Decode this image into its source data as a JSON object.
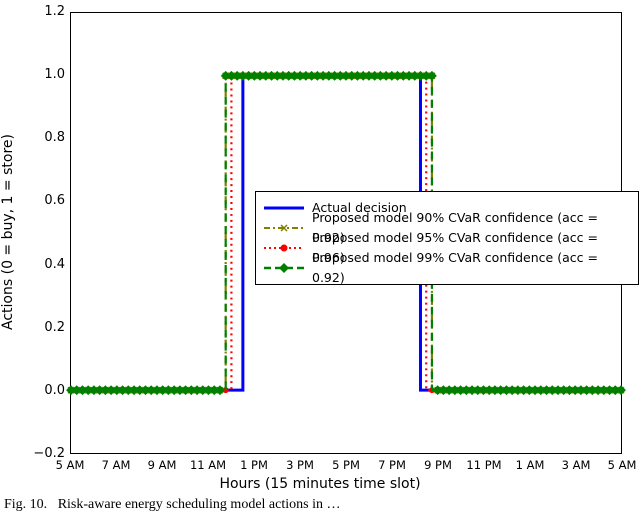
{
  "chart_data": {
    "type": "line",
    "title": "",
    "xlabel": "Hours (15 minutes time slot)",
    "ylabel": "Actions (0 = buy, 1 = store)",
    "xlim_hours": [
      5,
      29
    ],
    "ylim": [
      -0.2,
      1.2
    ],
    "x_tick_labels": [
      "5 AM",
      "7 AM",
      "9 AM",
      "11 AM",
      "1 PM",
      "3 PM",
      "5 PM",
      "7 PM",
      "9 PM",
      "11 PM",
      "1 AM",
      "3 AM",
      "5 AM"
    ],
    "x_tick_hours": [
      5,
      7,
      9,
      11,
      13,
      15,
      17,
      19,
      21,
      23,
      25,
      27,
      29
    ],
    "y_ticks": [
      -0.2,
      0.0,
      0.2,
      0.4,
      0.6,
      0.8,
      1.0,
      1.2
    ],
    "series": [
      {
        "name": "Actual decision",
        "style": "solid",
        "color": "#0000ff",
        "marker": "none",
        "rise_hour": 12.5,
        "fall_hour": 20.25
      },
      {
        "name": "Proposed model 90% CVaR confidence (acc = 0.92)",
        "style": "dashdot",
        "color": "#808000",
        "marker": "x",
        "rise_hour": 11.75,
        "fall_hour": 20.75
      },
      {
        "name": "Proposed model 95% CVaR confidence (acc = 0.96)",
        "style": "dot",
        "color": "#ff0000",
        "marker": "circle",
        "rise_hour": 12.0,
        "fall_hour": 20.5
      },
      {
        "name": "Proposed model 99% CVaR confidence (acc = 0.92)",
        "style": "dash",
        "color": "#008000",
        "marker": "diamond",
        "rise_hour": 11.75,
        "fall_hour": 20.75
      }
    ],
    "marker_step_hours": 0.25
  },
  "caption_prefix": "Fig. 10.",
  "caption_rest": "Risk-",
  "legend": {
    "entries": [
      "Actual decision",
      "Proposed model 90% CVaR confidence (acc = 0.92)",
      "Proposed model 95% CVaR confidence (acc = 0.96)",
      "Proposed model 99% CVaR confidence (acc = 0.92)"
    ]
  }
}
